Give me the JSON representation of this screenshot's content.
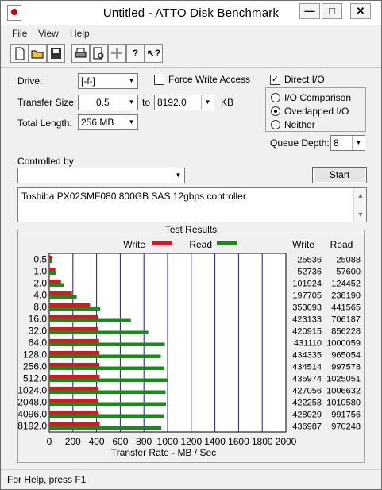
{
  "window": {
    "title": "Untitled - ATTO Disk Benchmark"
  },
  "caption_buttons": {
    "minimize": "—",
    "maximize": "□",
    "close": "✕"
  },
  "menu": {
    "items": [
      "File",
      "View",
      "Help"
    ]
  },
  "toolbar": {
    "icons": [
      "new-document-icon",
      "open-folder-icon",
      "save-icon",
      "print-icon",
      "print-preview-icon",
      "move-icon",
      "help-icon",
      "context-help-icon"
    ]
  },
  "settings": {
    "drive_label": "Drive:",
    "drive_value": "[-f-]",
    "transfer_size_label": "Transfer Size:",
    "transfer_from": "0.5",
    "to_label": "to",
    "transfer_to": "8192.0",
    "kb_label": "KB",
    "total_length_label": "Total Length:",
    "total_length_value": "256 MB",
    "force_write_label": "Force Write Access",
    "force_write_checked": false,
    "direct_io_label": "Direct I/O",
    "direct_io_checked": true,
    "io_options": [
      "I/O Comparison",
      "Overlapped I/O",
      "Neither"
    ],
    "io_selected": "Overlapped I/O",
    "queue_depth_label": "Queue Depth:",
    "queue_depth_value": "8",
    "controlled_by_label": "Controlled by:",
    "controlled_by_value": "",
    "start_label": "Start",
    "description": "Toshiba PX02SMF080 800GB SAS 12gbps controller"
  },
  "results": {
    "group_title": "Test Results",
    "legend_write": "Write",
    "legend_read": "Read",
    "col_write": "Write",
    "col_read": "Read",
    "x_axis_title": "Transfer Rate - MB / Sec",
    "write_color": "#e0141e",
    "read_color": "#1b8a1b",
    "grid_color": "#1a1ab0"
  },
  "chart_data": {
    "type": "bar",
    "orientation": "horizontal",
    "categories": [
      "0.5",
      "1.0",
      "2.0",
      "4.0",
      "8.0",
      "16.0",
      "32.0",
      "64.0",
      "128.0",
      "256.0",
      "512.0",
      "1024.0",
      "2048.0",
      "4096.0",
      "8192.0"
    ],
    "series": [
      {
        "name": "Write",
        "values": [
          25536,
          52736,
          101924,
          197705,
          353093,
          423133,
          420915,
          431110,
          434335,
          434514,
          435974,
          427056,
          422258,
          428029,
          436987
        ]
      },
      {
        "name": "Read",
        "values": [
          25088,
          57600,
          124452,
          238190,
          441565,
          706187,
          856228,
          1000059,
          965054,
          997578,
          1025051,
          1006632,
          1010580,
          991756,
          970248
        ]
      }
    ],
    "xlabel": "Transfer Rate - MB / Sec",
    "xticks": [
      "0",
      "200",
      "400",
      "600",
      "800",
      "1000",
      "1200",
      "1400",
      "1600",
      "1800",
      "2000"
    ],
    "xlim": [
      0,
      2000
    ],
    "value_units": "KB/s",
    "legend": "top"
  },
  "status": {
    "text": "For Help, press F1"
  }
}
